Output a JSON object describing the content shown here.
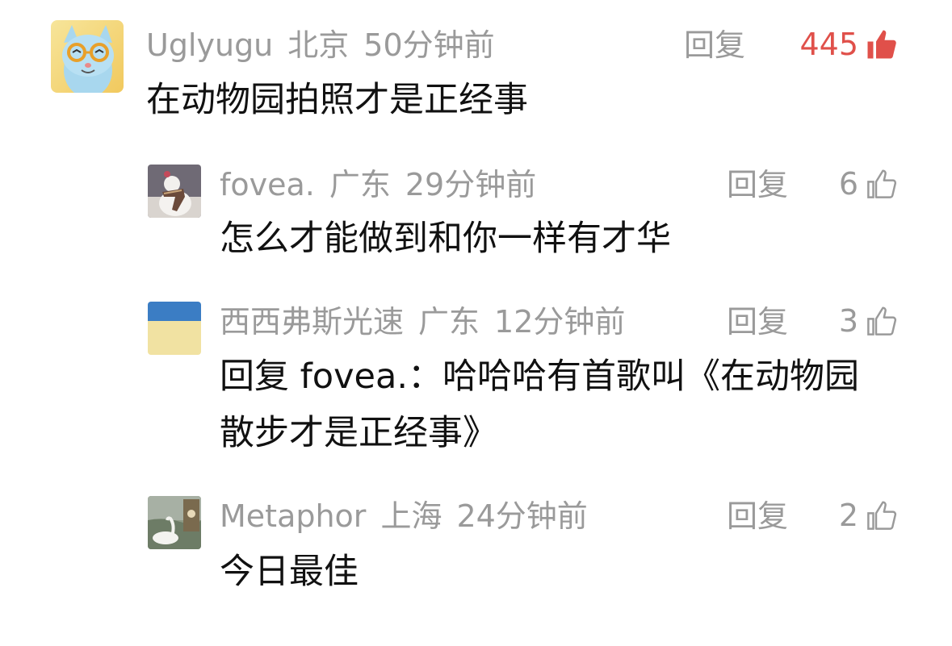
{
  "comments": [
    {
      "user": "Uglyugu",
      "location": "北京",
      "time": "50分钟前",
      "reply_label": "回复",
      "likes": "445",
      "liked": true,
      "text": "在动物园拍照才是正经事",
      "avatar_icon": "cartoon-cat-with-glasses-avatar"
    }
  ],
  "replies": [
    {
      "user": "fovea.",
      "location": "广东",
      "time": "29分钟前",
      "reply_label": "回复",
      "likes": "6",
      "text": "怎么才能做到和你一样有才华",
      "avatar_icon": "snowman-photo-avatar"
    },
    {
      "user": "西西弗斯光速",
      "location": "广东",
      "time": "12分钟前",
      "reply_label": "回复",
      "likes": "3",
      "text_line1": "回复 fovea.：哈哈哈有首歌叫《在动物园",
      "text_line2": "散步才是正经事》",
      "avatar_icon": "blue-yellow-flag-avatar"
    },
    {
      "user": "Metaphor",
      "location": "上海",
      "time": "24分钟前",
      "reply_label": "回复",
      "likes": "2",
      "text": "今日最佳",
      "avatar_icon": "swan-photo-avatar"
    }
  ],
  "colors": {
    "meta_gray": "#9a9a9a",
    "like_red": "#e0504a",
    "text": "#111111"
  }
}
